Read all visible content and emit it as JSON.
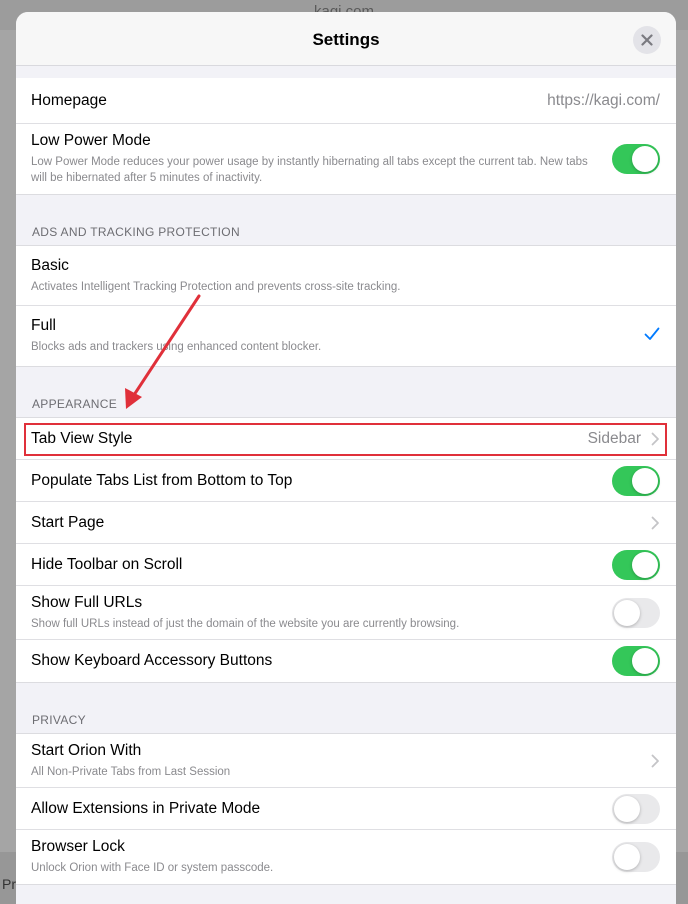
{
  "background": {
    "url_text": "kagi.com",
    "bottom_text": "Pr"
  },
  "modal": {
    "title": "Settings"
  },
  "general": {
    "homepage_label": "Homepage",
    "homepage_value": "https://kagi.com/",
    "low_power_label": "Low Power Mode",
    "low_power_sub": "Low Power Mode reduces your power usage by instantly hibernating all tabs except the current tab. New tabs will be hibernated after 5 minutes of inactivity."
  },
  "ads": {
    "header": "ADS AND TRACKING PROTECTION",
    "basic_label": "Basic",
    "basic_sub": "Activates Intelligent Tracking Protection and prevents cross-site tracking.",
    "full_label": "Full",
    "full_sub": "Blocks ads and trackers using enhanced content blocker."
  },
  "appearance": {
    "header": "APPEARANCE",
    "tab_view_label": "Tab View Style",
    "tab_view_value": "Sidebar",
    "populate_label": "Populate Tabs List from Bottom to Top",
    "start_page_label": "Start Page",
    "hide_toolbar_label": "Hide Toolbar on Scroll",
    "full_urls_label": "Show Full URLs",
    "full_urls_sub": "Show full URLs instead of just the domain of the website you are currently browsing.",
    "keyboard_label": "Show Keyboard Accessory Buttons"
  },
  "privacy": {
    "header": "PRIVACY",
    "start_with_label": "Start Orion With",
    "start_with_sub": "All Non-Private Tabs from Last Session",
    "extensions_label": "Allow Extensions in Private Mode",
    "lock_label": "Browser Lock",
    "lock_sub": "Unlock Orion with Face ID or system passcode."
  },
  "toggles": {
    "low_power": "on",
    "populate": "on",
    "hide_toolbar": "on",
    "full_urls": "off",
    "keyboard": "on",
    "extensions_private": "off",
    "browser_lock": "off"
  },
  "colors": {
    "toggle_on": "#34c759",
    "accent": "#007aff",
    "highlight": "#e0303a"
  }
}
